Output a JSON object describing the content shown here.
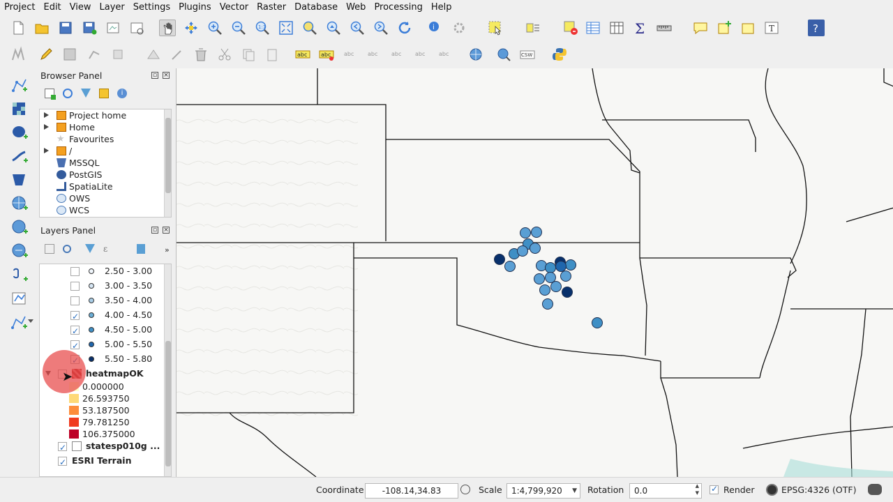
{
  "menu": [
    "Project",
    "Edit",
    "View",
    "Layer",
    "Settings",
    "Plugins",
    "Vector",
    "Raster",
    "Database",
    "Web",
    "Processing",
    "Help"
  ],
  "browser_panel": {
    "title": "Browser Panel",
    "items": [
      {
        "label": "Project home",
        "icon": "folder-icon",
        "arrow": true
      },
      {
        "label": "Home",
        "icon": "folder-icon",
        "arrow": true
      },
      {
        "label": "Favourites",
        "icon": "star-icon",
        "arrow": false
      },
      {
        "label": "/",
        "icon": "folder-icon",
        "arrow": true
      },
      {
        "label": "MSSQL",
        "icon": "mssql-icon",
        "arrow": false
      },
      {
        "label": "PostGIS",
        "icon": "postgis-icon",
        "arrow": false
      },
      {
        "label": "SpatiaLite",
        "icon": "spatialite-icon",
        "arrow": false
      },
      {
        "label": "OWS",
        "icon": "globe-icon",
        "arrow": false
      },
      {
        "label": "WCS",
        "icon": "globe-icon",
        "arrow": false
      }
    ]
  },
  "layers_panel": {
    "title": "Layers Panel",
    "classes": [
      {
        "label": "2.50 - 3.00",
        "checked": false,
        "color": "#f0f6fc"
      },
      {
        "label": "3.00 - 3.50",
        "checked": false,
        "color": "#d6e6f4"
      },
      {
        "label": "3.50 - 4.00",
        "checked": false,
        "color": "#a9cde6"
      },
      {
        "label": "4.00 - 4.50",
        "checked": true,
        "color": "#6baed6"
      },
      {
        "label": "4.50 - 5.00",
        "checked": true,
        "color": "#3f8fc5"
      },
      {
        "label": "5.00 - 5.50",
        "checked": true,
        "color": "#1f66ad"
      },
      {
        "label": "5.50 - 5.80",
        "checked": true,
        "color": "#08306b"
      }
    ],
    "heatmap_layer": "heatmapOK",
    "heatmap_ramp": [
      {
        "label": "0.000000",
        "color": "#ffffcc"
      },
      {
        "label": "26.593750",
        "color": "#fed976"
      },
      {
        "label": "53.187500",
        "color": "#fd8d3c"
      },
      {
        "label": "79.781250",
        "color": "#f03b20"
      },
      {
        "label": "106.375000",
        "color": "#bd0026"
      }
    ],
    "states_layer": "statesp010g ...",
    "terrain_layer": "ESRI Terrain"
  },
  "map": {
    "points": [
      {
        "mag": 4.3,
        "color": "#5a9fd4"
      },
      {
        "mag": 4.4,
        "color": "#5a9fd4"
      },
      {
        "mag": 4.6,
        "color": "#3f8fc5"
      },
      {
        "mag": 4.2,
        "color": "#5a9fd4"
      },
      {
        "mag": 4.5,
        "color": "#3f8fc5"
      },
      {
        "mag": 5.6,
        "color": "#08306b"
      },
      {
        "mag": 4.4,
        "color": "#5a9fd4"
      },
      {
        "mag": 4.3,
        "color": "#5a9fd4"
      },
      {
        "mag": 4.4,
        "color": "#5a9fd4"
      },
      {
        "mag": 5.7,
        "color": "#08306b"
      },
      {
        "mag": 4.6,
        "color": "#3f8fc5"
      },
      {
        "mag": 4.5,
        "color": "#3f8fc5"
      },
      {
        "mag": 5.2,
        "color": "#1f66ad"
      },
      {
        "mag": 4.4,
        "color": "#5a9fd4"
      },
      {
        "mag": 4.3,
        "color": "#5a9fd4"
      },
      {
        "mag": 4.4,
        "color": "#5a9fd4"
      },
      {
        "mag": 5.8,
        "color": "#08306b"
      },
      {
        "mag": 4.3,
        "color": "#5a9fd4"
      },
      {
        "mag": 4.4,
        "color": "#5a9fd4"
      },
      {
        "mag": 4.2,
        "color": "#5a9fd4"
      },
      {
        "mag": 4.5,
        "color": "#3f8fc5"
      }
    ]
  },
  "status": {
    "coordinate_label": "Coordinate",
    "coordinate_value": "-108.14,34.83",
    "scale_label": "Scale",
    "scale_value": "1:4,799,920",
    "rotation_label": "Rotation",
    "rotation_value": "0.0",
    "render_label": "Render",
    "render_checked": true,
    "crs": "EPSG:4326 (OTF)"
  }
}
